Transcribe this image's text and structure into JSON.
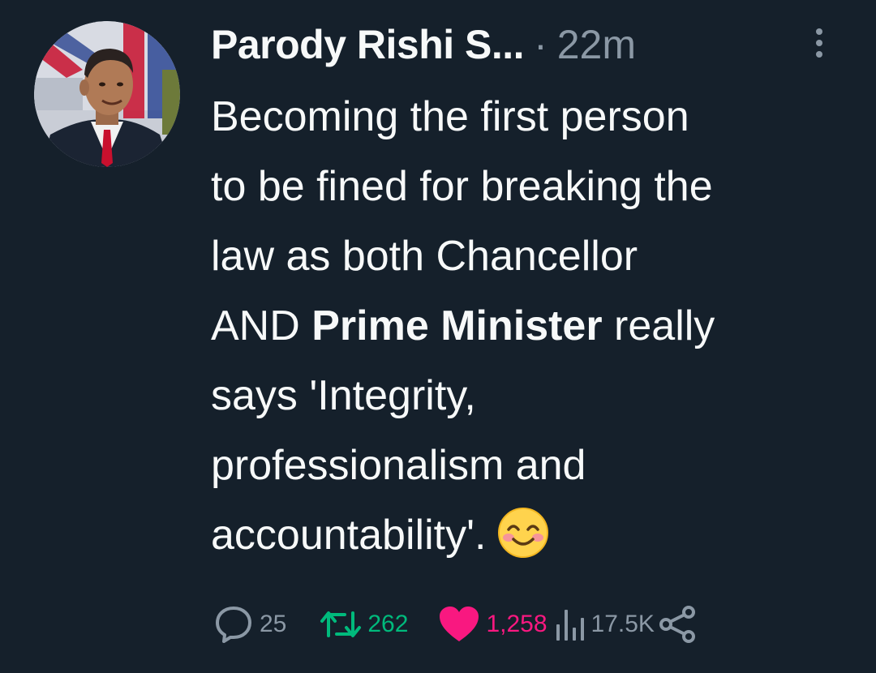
{
  "tweet": {
    "display_name": "Parody Rishi S...",
    "separator": "·",
    "timestamp": "22m",
    "text_lines": {
      "l1": "Becoming the first person",
      "l2": "to be fined for breaking the",
      "l3": "law as both Chancellor",
      "l4a": "AND ",
      "l4b": "Prime Minister",
      "l4c": " really",
      "l5": "says 'Integrity,",
      "l6": "professionalism and",
      "l7": "accountability'."
    },
    "emoji": "smiling-face-with-smiling-eyes"
  },
  "actions": {
    "replies": "25",
    "retweets": "262",
    "likes": "1,258",
    "views": "17.5K"
  },
  "icons": {
    "reply": "speech-bubble-icon",
    "retweet": "retweet-icon",
    "like": "heart-icon",
    "views": "bar-chart-icon",
    "share": "share-icon",
    "more": "more-vertical-icon"
  },
  "colors": {
    "background": "#15202b",
    "text": "#f7f9f9",
    "muted": "#8b98a5",
    "retweet_green": "#00ba7c",
    "like_pink": "#f91880"
  }
}
